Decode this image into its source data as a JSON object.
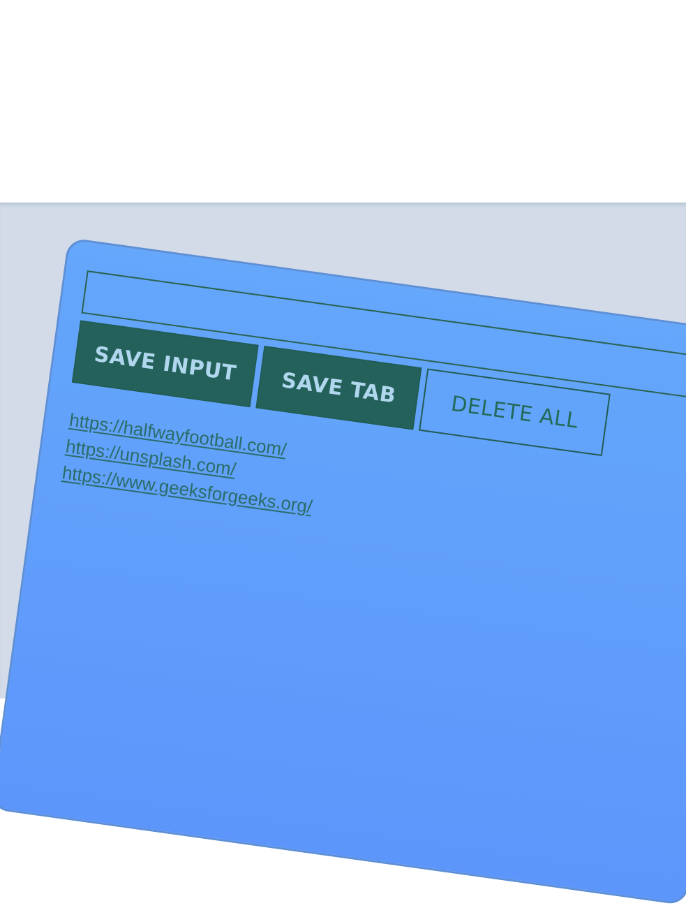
{
  "input": {
    "value": "",
    "placeholder": ""
  },
  "buttons": {
    "save_input": "SAVE INPUT",
    "save_tab": "SAVE TAB",
    "delete_all": "DELETE ALL"
  },
  "links": [
    "https://halfwayfootball.com/",
    "https://unsplash.com/",
    "https://www.geeksforgeeks.org/"
  ],
  "colors": {
    "background": "#d2dbe7",
    "panel": "#64a7fb",
    "panel_border": "#5d8fd8",
    "button_solid": "#25615b",
    "button_text": "#b0d7ee",
    "link": "#2a6d68"
  }
}
